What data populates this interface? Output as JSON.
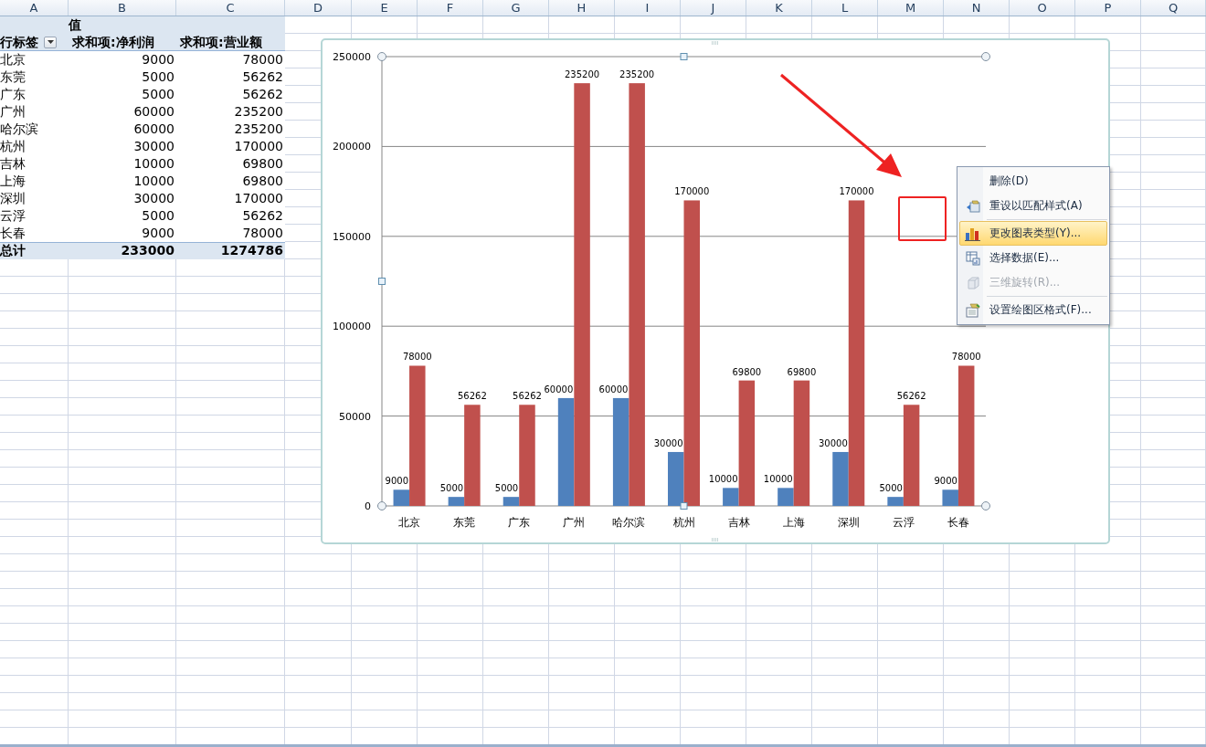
{
  "columns": [
    "A",
    "B",
    "C",
    "D",
    "E",
    "F",
    "G",
    "H",
    "I",
    "J",
    "K",
    "L",
    "M",
    "N",
    "O",
    "P",
    "Q"
  ],
  "pivot": {
    "values_label": "值",
    "row_label": "行标签",
    "headers": [
      "求和项:净利润",
      "求和项:营业额"
    ],
    "rows": [
      {
        "label": "北京",
        "values": [
          "9000",
          "78000"
        ]
      },
      {
        "label": "东莞",
        "values": [
          "5000",
          "56262"
        ]
      },
      {
        "label": "广东",
        "values": [
          "5000",
          "56262"
        ]
      },
      {
        "label": "广州",
        "values": [
          "60000",
          "235200"
        ]
      },
      {
        "label": "哈尔滨",
        "values": [
          "60000",
          "235200"
        ]
      },
      {
        "label": "杭州",
        "values": [
          "30000",
          "170000"
        ]
      },
      {
        "label": "吉林",
        "values": [
          "10000",
          "69800"
        ]
      },
      {
        "label": "上海",
        "values": [
          "10000",
          "69800"
        ]
      },
      {
        "label": "深圳",
        "values": [
          "30000",
          "170000"
        ]
      },
      {
        "label": "云浮",
        "values": [
          "5000",
          "56262"
        ]
      },
      {
        "label": "长春",
        "values": [
          "9000",
          "78000"
        ]
      }
    ],
    "total": {
      "label": "总计",
      "values": [
        "233000",
        "1274786"
      ]
    }
  },
  "chart": {
    "chart_data": {
      "type": "bar",
      "categories": [
        "北京",
        "东莞",
        "广东",
        "广州",
        "哈尔滨",
        "杭州",
        "吉林",
        "上海",
        "深圳",
        "云浮",
        "长春"
      ],
      "series": [
        {
          "color": "#4f81bd",
          "values": [
            9000,
            5000,
            5000,
            60000,
            60000,
            30000,
            10000,
            10000,
            30000,
            5000,
            9000
          ]
        },
        {
          "color": "#c0504d",
          "values": [
            78000,
            56262,
            56262,
            235200,
            235200,
            170000,
            69800,
            69800,
            170000,
            56262,
            78000
          ]
        }
      ],
      "ylim": [
        0,
        250000
      ],
      "yticks": [
        0,
        50000,
        100000,
        150000,
        200000,
        250000
      ],
      "grid": true,
      "data_labels": true
    }
  },
  "context_menu": {
    "items": [
      {
        "label": "删除(D)",
        "kind": "none",
        "disabled": false,
        "selected": false,
        "separator_before": false
      },
      {
        "label": "重设以匹配样式(A)",
        "kind": "reset",
        "disabled": false,
        "selected": false,
        "separator_before": false
      },
      {
        "label": "更改图表类型(Y)...",
        "kind": "chart",
        "disabled": false,
        "selected": true,
        "separator_before": true
      },
      {
        "label": "选择数据(E)...",
        "kind": "table",
        "disabled": false,
        "selected": false,
        "separator_before": false
      },
      {
        "label": "三维旋转(R)...",
        "kind": "cube",
        "disabled": true,
        "selected": false,
        "separator_before": false
      },
      {
        "label": "设置绘图区格式(F)...",
        "kind": "format",
        "disabled": false,
        "selected": false,
        "separator_before": true
      }
    ]
  }
}
